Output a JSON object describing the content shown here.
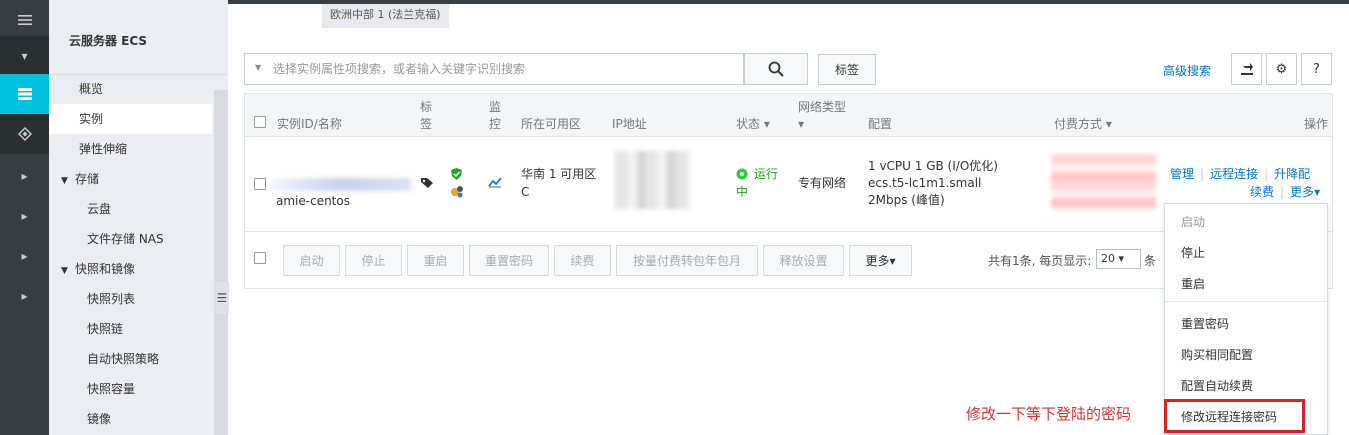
{
  "sidebar": {
    "title": "云服务器 ECS",
    "items": [
      {
        "label": "概览"
      },
      {
        "label": "实例"
      },
      {
        "label": "弹性伸缩"
      },
      {
        "label": "存储"
      },
      {
        "label": "云盘"
      },
      {
        "label": "文件存储 NAS"
      },
      {
        "label": "快照和镜像"
      },
      {
        "label": "快照列表"
      },
      {
        "label": "快照链"
      },
      {
        "label": "自动快照策略"
      },
      {
        "label": "快照容量"
      },
      {
        "label": "镜像"
      }
    ]
  },
  "header": {
    "region": "欧洲中部 1 (法兰克福)"
  },
  "search": {
    "placeholder": "选择实例属性项搜索，或者输入关键字识别搜索",
    "tag_label": "标签",
    "advanced_label": "高级搜索"
  },
  "table": {
    "headers": {
      "id_name": "实例ID/名称",
      "tag_1": "标",
      "tag_2": "签",
      "monitor_1": "监",
      "monitor_2": "控",
      "zone": "所在可用区",
      "ip": "IP地址",
      "status": "状态 ▾",
      "network_1": "网络类型",
      "network_2": "▾",
      "config": "配置",
      "billing": "付费方式 ▾",
      "actions": "操作"
    },
    "row": {
      "name": "amie-centos",
      "zone_1": "华南 1 可用区",
      "zone_2": "C",
      "status_1": "运行",
      "status_2": "中",
      "network": "专有网络",
      "config_1": "1 vCPU 1 GB (I/O优化)",
      "config_2": "ecs.t5-lc1m1.small",
      "config_3": "2Mbps (峰值)",
      "action_manage": "管理",
      "action_remote": "远程连接",
      "action_upgrade": "升降配",
      "action_renew": "续费",
      "action_more": "更多▾"
    }
  },
  "batch_actions": {
    "start": "启动",
    "stop": "停止",
    "restart": "重启",
    "reset_password": "重置密码",
    "renew": "续费",
    "convert_billing": "按量付费转包年包月",
    "release_settings": "释放设置",
    "more": "更多▾"
  },
  "pagination": {
    "summary": "共有1条, 每页显示:",
    "page_size": "20 ▾",
    "suffix": "条"
  },
  "dropdown": {
    "items": [
      {
        "label": "启动"
      },
      {
        "label": "停止"
      },
      {
        "label": "重启"
      },
      {
        "label": "重置密码"
      },
      {
        "label": "购买相同配置"
      },
      {
        "label": "配置自动续费"
      },
      {
        "label": "修改远程连接密码"
      }
    ]
  },
  "annotation": {
    "text": "修改一下等下登陆的密码",
    "color": "#e03030"
  },
  "colors": {
    "accent": "#00c1de",
    "link": "#0077cc",
    "status_running": "#2ecc40",
    "iconbar": "#373d41",
    "sidebar": "#eaedf1"
  },
  "icons": [
    "menu-icon",
    "database-icon",
    "layers-icon",
    "search-icon",
    "export-icon",
    "gear-icon",
    "help-icon",
    "tag-icon",
    "shield-icon",
    "monitor-chart-icon",
    "collapse-icon"
  ]
}
